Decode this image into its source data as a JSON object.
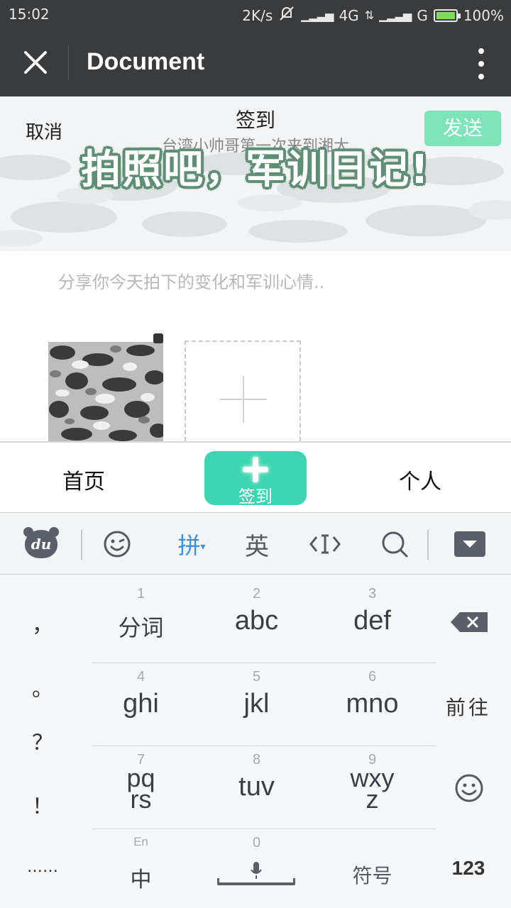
{
  "status_bar": {
    "time": "15:02",
    "net_speed": "2K/s",
    "network1": "4G",
    "network2": "G",
    "battery": "100%",
    "battery_level": 1.0
  },
  "titlebar": {
    "title": "Document"
  },
  "post": {
    "cancel_label": "取消",
    "title": "签到",
    "subtitle": "台湾小帅哥第一次来到湘大",
    "send_label": "发送",
    "banner_headline": "拍照吧，军训日记!",
    "placeholder": "分享你今天拍下的变化和军训心情.."
  },
  "bottom_nav": {
    "home": "首页",
    "signin": "签到",
    "me": "个人"
  },
  "keyboard": {
    "toolbar": {
      "logo_text": "du",
      "pinyin": "拼",
      "english": "英"
    },
    "punct": [
      "，",
      "。",
      "？",
      "！",
      "……"
    ],
    "keys": [
      {
        "num": "1",
        "label": "分词"
      },
      {
        "num": "2",
        "label": "abc"
      },
      {
        "num": "3",
        "label": "def"
      },
      {
        "num": "4",
        "label": "ghi"
      },
      {
        "num": "5",
        "label": "jkl"
      },
      {
        "num": "6",
        "label": "mno"
      },
      {
        "num": "7",
        "label": "pqrs"
      },
      {
        "num": "8",
        "label": "tuv"
      },
      {
        "num": "9",
        "label": "wxyz"
      }
    ],
    "bottom_row": {
      "lang_small": "En",
      "lang_main": "中",
      "zero": "0",
      "symbols": "符号",
      "numbers": "123"
    },
    "goto_label": "前往"
  },
  "colors": {
    "bar_dark": "#3a3b3d",
    "accent_green": "#3dd6b0",
    "send_green": "#7ee3b8",
    "pinyin_blue": "#3b8fe4"
  }
}
